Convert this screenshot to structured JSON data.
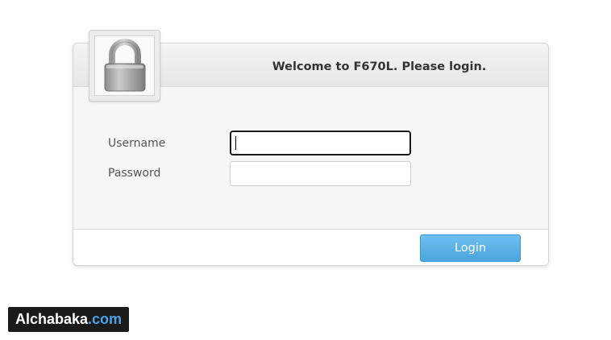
{
  "login_panel": {
    "title": "Welcome to F670L. Please login.",
    "username_label": "Username",
    "password_label": "Password",
    "username_value": "",
    "password_value": "",
    "login_button_label": "Login"
  },
  "icons": {
    "lock": "padlock-icon"
  },
  "watermark": {
    "brand": "Alchabaka",
    "tld": ".com"
  },
  "colors": {
    "login_button": "#4aa4dd",
    "watermark_background": "#1a1a1a",
    "watermark_tld": "#4aa3e8"
  }
}
